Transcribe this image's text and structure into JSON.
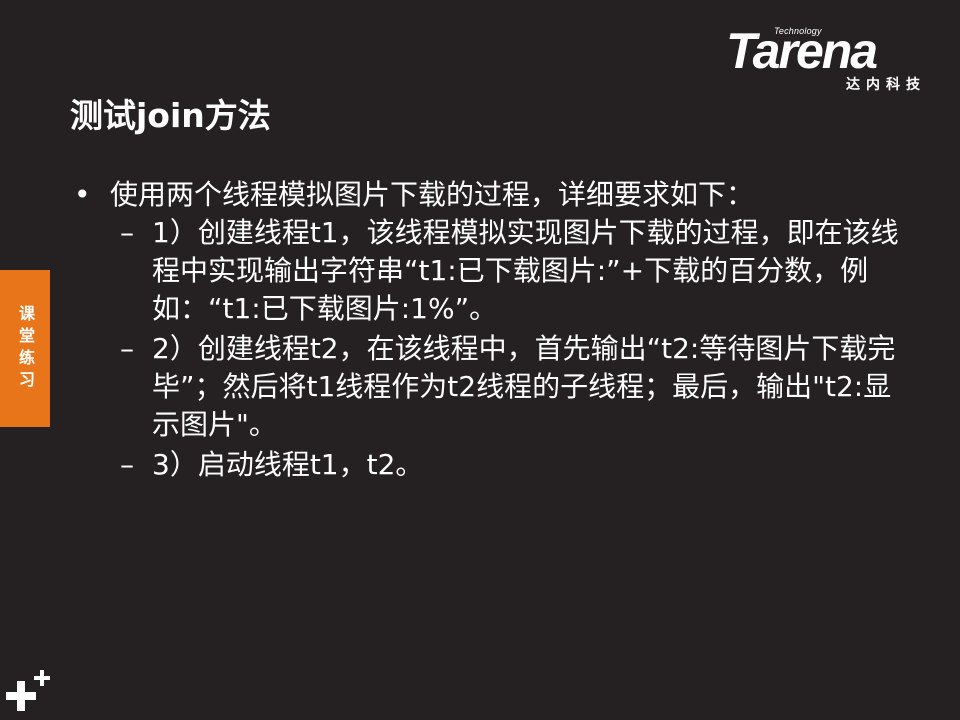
{
  "logo": {
    "technology": "Technology",
    "wordmark": "Tarena",
    "subtitle": "达内科技"
  },
  "title": "测试join方法",
  "side_tab": "课堂练习",
  "bullet": {
    "marker": "•",
    "text": "使用两个线程模拟图片下载的过程，详细要求如下："
  },
  "sub_items": [
    {
      "marker": "–",
      "text": "1）创建线程t1，该线程模拟实现图片下载的过程，即在该线程中实现输出字符串“t1:已下载图片:”+下载的百分数，例如：“t1:已下载图片:1%”。"
    },
    {
      "marker": "–",
      "text": "2）创建线程t2，在该线程中，首先输出“t2:等待图片下载完毕”；然后将t1线程作为t2线程的子线程；最后，输出\"t2:显示图片\"。"
    },
    {
      "marker": "–",
      "text": "3）启动线程t1，t2。"
    }
  ],
  "colors": {
    "background": "#252122",
    "accent": "#e8751a",
    "text": "#ffffff"
  }
}
